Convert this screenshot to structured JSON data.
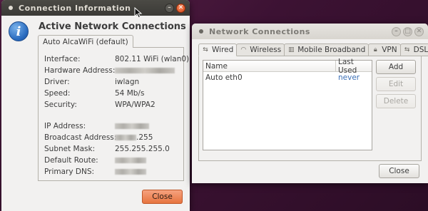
{
  "colors": {
    "desktop": "#3c1233",
    "accent_orange": "#e7743f",
    "link_blue": "#3b6fb6"
  },
  "conn_info": {
    "window_title": "Connection Information",
    "heading": "Active Network Connections",
    "tab_label": "Auto AlcaWiFi (default)",
    "rows": [
      {
        "label": "Interface:",
        "value": "802.11 WiFi (wlan0)"
      },
      {
        "label": "Hardware Address:",
        "value": ""
      },
      {
        "label": "Driver:",
        "value": "iwlagn"
      },
      {
        "label": "Speed:",
        "value": "54 Mb/s"
      },
      {
        "label": "Security:",
        "value": "WPA/WPA2"
      },
      {
        "label": "IP Address:",
        "value": ""
      },
      {
        "label": "Broadcast Address:",
        "value": ".255"
      },
      {
        "label": "Subnet Mask:",
        "value": "255.255.255.0"
      },
      {
        "label": "Default Route:",
        "value": ""
      },
      {
        "label": "Primary DNS:",
        "value": ""
      }
    ],
    "close_label": "Close",
    "icon": "info-icon"
  },
  "net_conn": {
    "window_title": "Network Connections",
    "tabs": [
      {
        "label": "Wired",
        "icon": "wired-icon"
      },
      {
        "label": "Wireless",
        "icon": "wireless-icon"
      },
      {
        "label": "Mobile Broadband",
        "icon": "mobile-broadband-icon"
      },
      {
        "label": "VPN",
        "icon": "vpn-lock-icon"
      },
      {
        "label": "DSL",
        "icon": "dsl-icon"
      }
    ],
    "columns": {
      "name": "Name",
      "last_used": "Last Used"
    },
    "rows": [
      {
        "name": "Auto eth0",
        "last_used": "never"
      }
    ],
    "buttons": {
      "add": "Add",
      "edit": "Edit",
      "delete": "Delete",
      "close": "Close"
    }
  }
}
